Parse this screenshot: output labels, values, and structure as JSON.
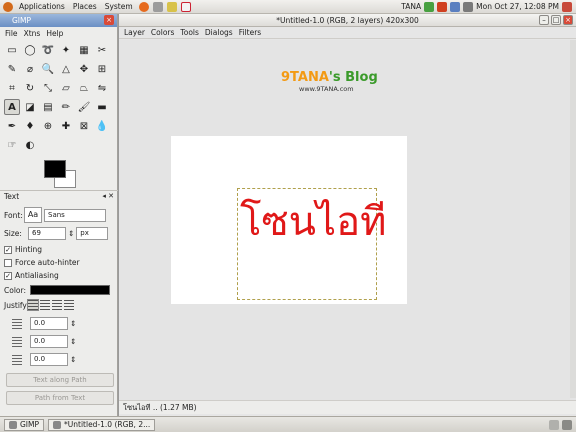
{
  "top_panel": {
    "menus": [
      "Applications",
      "Places",
      "System"
    ],
    "user": "TANA",
    "clock": "Mon Oct 27, 12:08 PM"
  },
  "canvas_window": {
    "title": "*Untitled-1.0 (RGB, 2 layers) 420x300",
    "menus": [
      "Layer",
      "Colors",
      "Tools",
      "Dialogs",
      "Filters"
    ],
    "blog_title_part1": "9TANA",
    "blog_title_part2": "'s Blog",
    "blog_url": "www.9TANA.com",
    "text_content": "โซนไอที",
    "status": "โซนไอที .. (1.27 MB)"
  },
  "toolbox": {
    "title": "GIMP",
    "menus": [
      "File",
      "Xtns",
      "Help"
    ],
    "tools": [
      "rect-select",
      "ellipse-select",
      "free-select",
      "fuzzy-select",
      "select-by-color",
      "scissors",
      "paths",
      "color-picker",
      "zoom",
      "measure",
      "move",
      "align",
      "crop",
      "rotate",
      "scale",
      "shear",
      "perspective",
      "flip",
      "text",
      "bucket-fill",
      "blend",
      "pencil",
      "paintbrush",
      "eraser",
      "airbrush",
      "ink",
      "clone",
      "heal",
      "perspective-clone",
      "convolve",
      "smudge",
      "dodge-burn"
    ],
    "active_tool": "text"
  },
  "tool_options": {
    "title": "Text",
    "font_label": "Font:",
    "font_preview": "Aa",
    "font_value": "Sans",
    "size_label": "Size:",
    "size_value": "69",
    "size_unit": "px",
    "hinting_label": "Hinting",
    "hinting": true,
    "force_autohinter_label": "Force auto-hinter",
    "force_autohinter": false,
    "antialiasing_label": "Antialiasing",
    "antialiasing": true,
    "color_label": "Color:",
    "justify_label": "Justify:",
    "indent_value": "0.0",
    "line_spacing_value": "0.0",
    "letter_spacing_value": "0.0",
    "text_along_path": "Text along Path",
    "path_from_text": "Path from Text"
  },
  "bottom_panel": {
    "tasks": [
      "GIMP",
      "*Untitled-1.0 (RGB, 2..."
    ]
  },
  "colors": {
    "text_red": "#e01818",
    "blog_orange": "#f39a14",
    "blog_green": "#3a9a2a"
  }
}
